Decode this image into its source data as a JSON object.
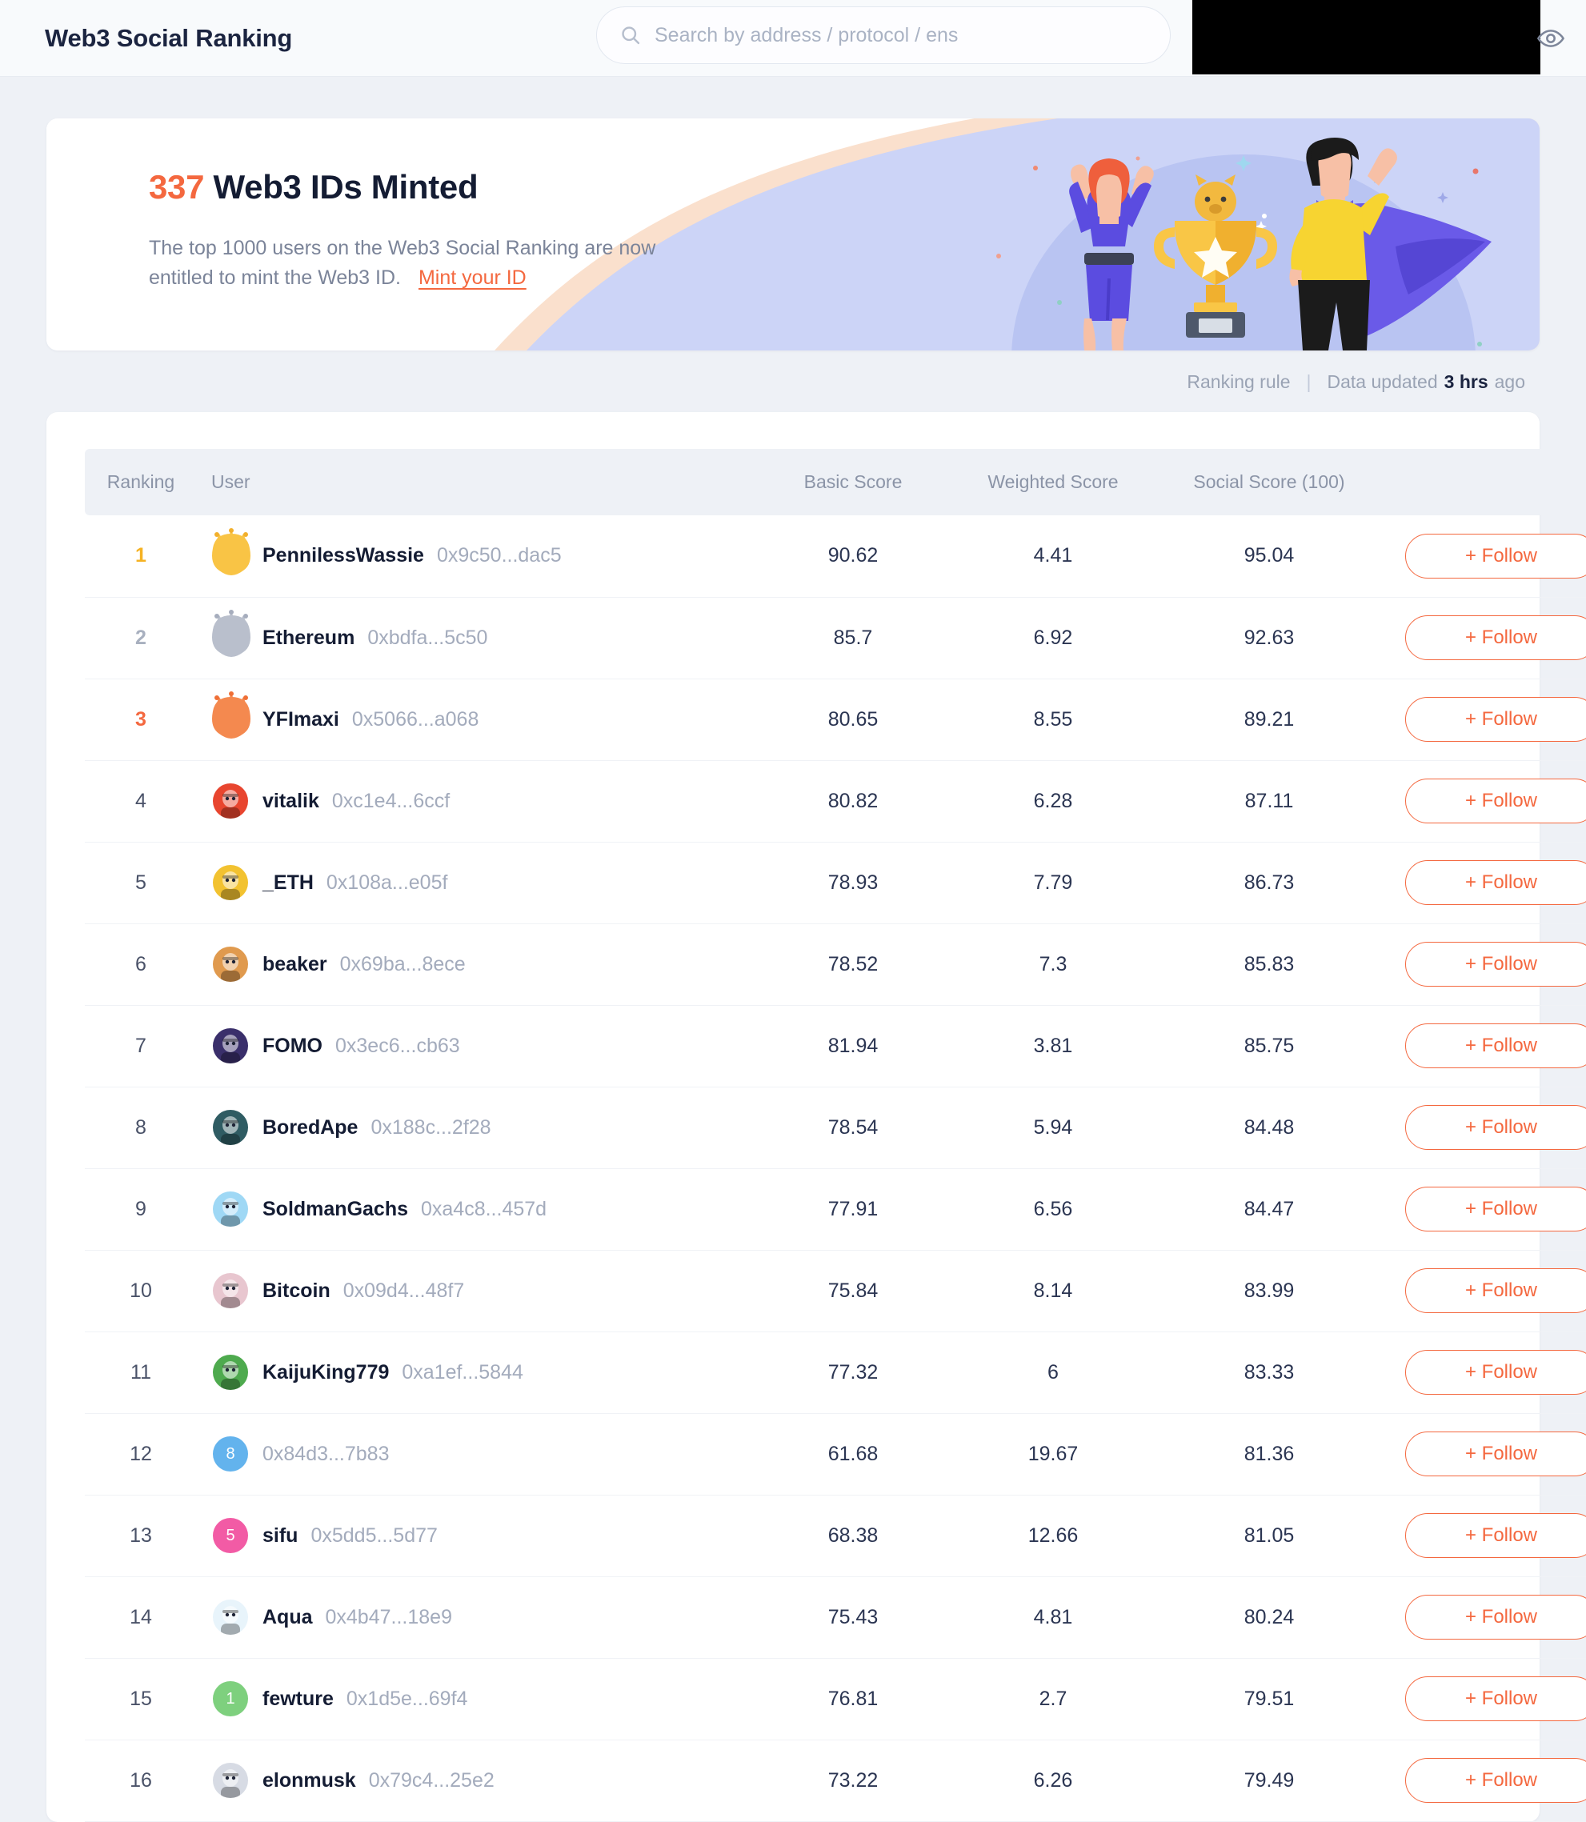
{
  "header": {
    "brand": "Web3 Social Ranking",
    "search": {
      "placeholder": "Search by address / protocol / ens",
      "value": ""
    },
    "eye_icon": "eye-icon",
    "search_icon": "search-icon"
  },
  "banner": {
    "count": "337",
    "title_rest": " Web3 IDs Minted",
    "description_line1": "The top 1000 users on the Web3 Social Ranking are now",
    "description_line2": "entitled to mint the Web3 ID.",
    "mint_link": "Mint your ID"
  },
  "meta": {
    "ranking_rule": "Ranking rule",
    "separator": "|",
    "data_updated_prefix": "Data updated",
    "hrs": "3 hrs",
    "ago": "ago"
  },
  "table": {
    "columns": {
      "ranking": "Ranking",
      "user": "User",
      "basic": "Basic Score",
      "weighted": "Weighted Score",
      "social": "Social Score (100)",
      "action": ""
    },
    "follow_label": "+ Follow",
    "rows": [
      {
        "rank": "1",
        "name": "PennilessWassie",
        "address": "0x9c50...dac5",
        "basic": "90.62",
        "weighted": "4.41",
        "social": "95.04",
        "avatar_type": "image",
        "avatar_bg": "#e0a53d",
        "crown": "gold",
        "follow": "+ Follow"
      },
      {
        "rank": "2",
        "name": "Ethereum",
        "address": "0xbdfa...5c50",
        "basic": "85.7",
        "weighted": "6.92",
        "social": "92.63",
        "avatar_type": "image",
        "avatar_bg": "#f09133",
        "crown": "silver",
        "follow": "+ Follow"
      },
      {
        "rank": "3",
        "name": "YFImaxi",
        "address": "0x5066...a068",
        "basic": "80.65",
        "weighted": "8.55",
        "social": "89.21",
        "avatar_type": "image",
        "avatar_bg": "#f0784a",
        "crown": "bronze",
        "follow": "+ Follow"
      },
      {
        "rank": "4",
        "name": "vitalik",
        "address": "0xc1e4...6ccf",
        "basic": "80.82",
        "weighted": "6.28",
        "social": "87.11",
        "avatar_type": "image",
        "avatar_bg": "#e8452f",
        "crown": "",
        "follow": "+ Follow"
      },
      {
        "rank": "5",
        "name": "_ETH",
        "address": "0x108a...e05f",
        "basic": "78.93",
        "weighted": "7.79",
        "social": "86.73",
        "avatar_type": "image",
        "avatar_bg": "#f2c230",
        "crown": "",
        "follow": "+ Follow"
      },
      {
        "rank": "6",
        "name": "beaker",
        "address": "0x69ba...8ece",
        "basic": "78.52",
        "weighted": "7.3",
        "social": "85.83",
        "avatar_type": "image",
        "avatar_bg": "#e09a4e",
        "crown": "",
        "follow": "+ Follow"
      },
      {
        "rank": "7",
        "name": "FOMO",
        "address": "0x3ec6...cb63",
        "basic": "81.94",
        "weighted": "3.81",
        "social": "85.75",
        "avatar_type": "image",
        "avatar_bg": "#3a2f6b",
        "crown": "",
        "follow": "+ Follow"
      },
      {
        "rank": "8",
        "name": "BoredApe",
        "address": "0x188c...2f28",
        "basic": "78.54",
        "weighted": "5.94",
        "social": "84.48",
        "avatar_type": "image",
        "avatar_bg": "#2f5c63",
        "crown": "",
        "follow": "+ Follow"
      },
      {
        "rank": "9",
        "name": "SoldmanGachs",
        "address": "0xa4c8...457d",
        "basic": "77.91",
        "weighted": "6.56",
        "social": "84.47",
        "avatar_type": "image",
        "avatar_bg": "#9fd8f5",
        "crown": "",
        "follow": "+ Follow"
      },
      {
        "rank": "10",
        "name": "Bitcoin",
        "address": "0x09d4...48f7",
        "basic": "75.84",
        "weighted": "8.14",
        "social": "83.99",
        "avatar_type": "image",
        "avatar_bg": "#e8c6cf",
        "crown": "",
        "follow": "+ Follow"
      },
      {
        "rank": "11",
        "name": "KaijuKing779",
        "address": "0xa1ef...5844",
        "basic": "77.32",
        "weighted": "6",
        "social": "83.33",
        "avatar_type": "image",
        "avatar_bg": "#4eaa4e",
        "crown": "",
        "follow": "+ Follow"
      },
      {
        "rank": "12",
        "name": "",
        "address": "0x84d3...7b83",
        "basic": "61.68",
        "weighted": "19.67",
        "social": "81.36",
        "avatar_type": "initial",
        "avatar_bg": "#63b3ed",
        "initial": "8",
        "crown": "",
        "follow": "+ Follow"
      },
      {
        "rank": "13",
        "name": "sifu",
        "address": "0x5dd5...5d77",
        "basic": "68.38",
        "weighted": "12.66",
        "social": "81.05",
        "avatar_type": "initial",
        "avatar_bg": "#f25ba5",
        "initial": "5",
        "crown": "",
        "follow": "+ Follow"
      },
      {
        "rank": "14",
        "name": "Aqua",
        "address": "0x4b47...18e9",
        "basic": "75.43",
        "weighted": "4.81",
        "social": "80.24",
        "avatar_type": "image",
        "avatar_bg": "#e8f4fb",
        "crown": "",
        "follow": "+ Follow"
      },
      {
        "rank": "15",
        "name": "fewture",
        "address": "0x1d5e...69f4",
        "basic": "76.81",
        "weighted": "2.7",
        "social": "79.51",
        "avatar_type": "initial",
        "avatar_bg": "#7ed07e",
        "initial": "1",
        "crown": "",
        "follow": "+ Follow"
      },
      {
        "rank": "16",
        "name": "elonmusk",
        "address": "0x79c4...25e2",
        "basic": "73.22",
        "weighted": "6.26",
        "social": "79.49",
        "avatar_type": "image",
        "avatar_bg": "#d7dbe4",
        "crown": "",
        "follow": "+ Follow"
      }
    ]
  },
  "colors": {
    "accent": "#f4683f",
    "gold": "#f5b223",
    "silver": "#a8b0bf",
    "bronze": "#f4683f",
    "page_bg": "#eef1f6",
    "card_bg": "#ffffff",
    "text_primary": "#141c33",
    "text_muted": "#a3abbc"
  }
}
